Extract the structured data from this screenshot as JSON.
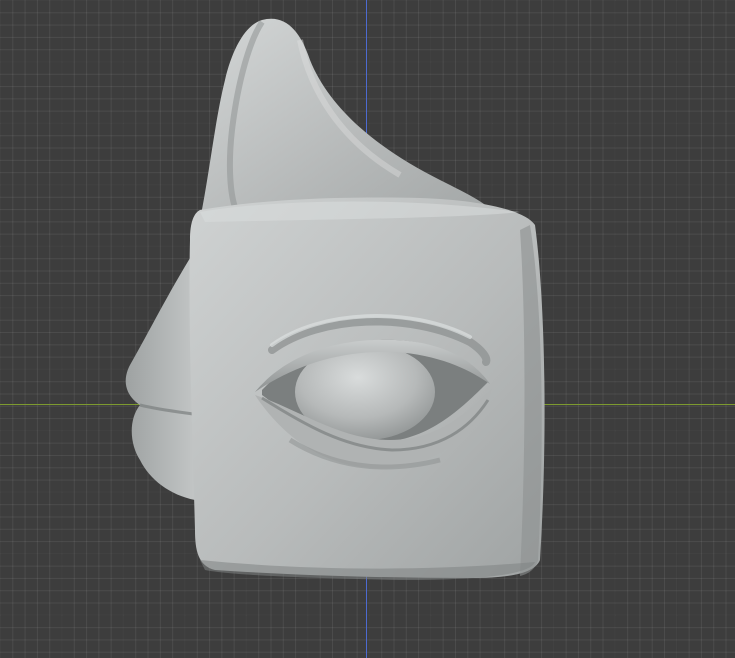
{
  "viewport": {
    "grid_background": "#3d3d3d",
    "axis_x_color": "#7d9a2f",
    "axis_y_color": "#4d6bd1"
  },
  "model": {
    "description_icon": "sculpted-cube-face-icon",
    "surface_color": "#b9bcbc"
  }
}
